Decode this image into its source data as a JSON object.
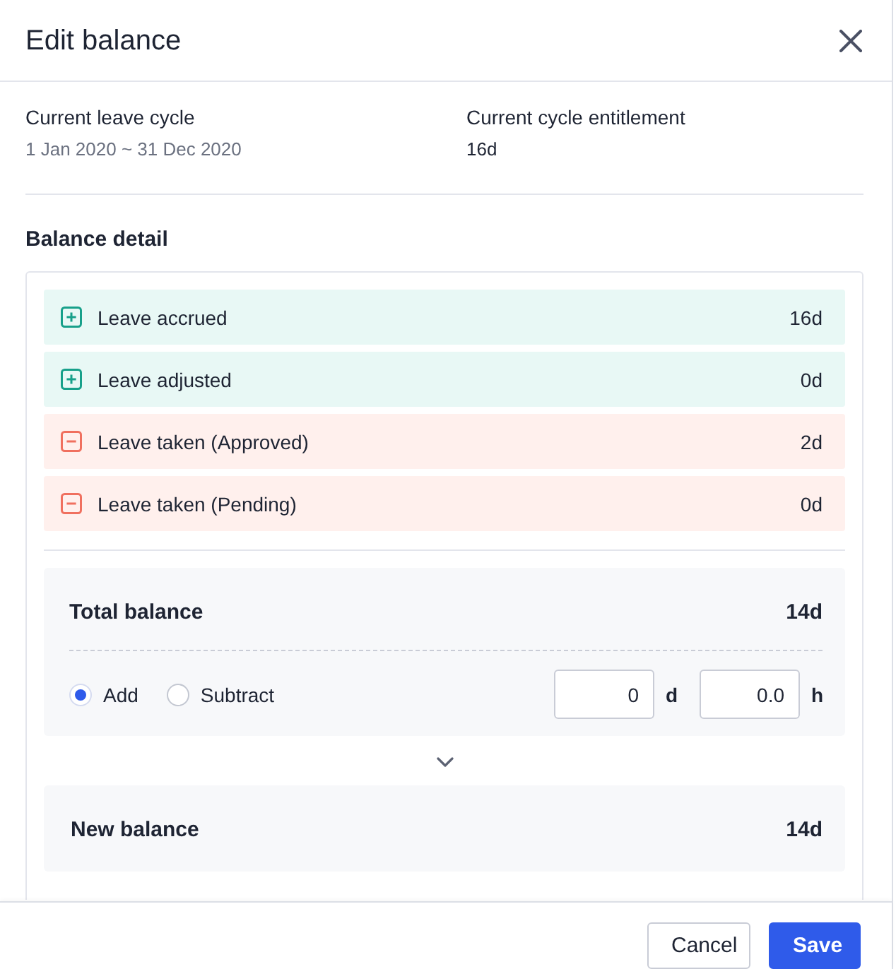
{
  "dialog": {
    "title": "Edit balance"
  },
  "info": [
    {
      "kind": "date_range",
      "label": "Current leave cycle",
      "value": "1 Jan 2020 ~ 31 Dec 2020"
    },
    {
      "kind": "amount",
      "label": "Current cycle entitlement",
      "value": "16d"
    }
  ],
  "balance_detail": {
    "heading": "Balance detail",
    "items": [
      {
        "kind": "plus",
        "label": "Leave accrued",
        "value": "16d"
      },
      {
        "kind": "plus",
        "label": "Leave adjusted",
        "value": "0d"
      },
      {
        "kind": "minus",
        "label": "Leave taken (Approved)",
        "value": "2d"
      },
      {
        "kind": "minus",
        "label": "Leave taken (Pending)",
        "value": "0d"
      }
    ]
  },
  "total": {
    "label": "Total balance",
    "value": "14d"
  },
  "adjustment": {
    "options": [
      {
        "label": "Add",
        "selected": true
      },
      {
        "label": "Subtract",
        "selected": false
      }
    ],
    "fields": [
      {
        "value": "0",
        "unit": "d"
      },
      {
        "value": "0.0",
        "unit": "h"
      }
    ]
  },
  "new_balance": {
    "label": "New balance",
    "value": "14d"
  },
  "buttons": [
    {
      "kind": "cancel",
      "label": "Cancel"
    },
    {
      "kind": "save",
      "label": "Save"
    }
  ]
}
